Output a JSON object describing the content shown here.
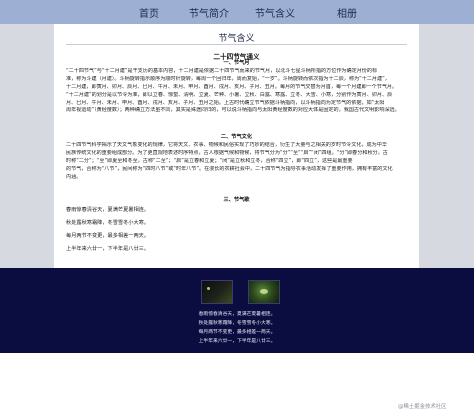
{
  "nav": {
    "items": [
      {
        "label": "首页"
      },
      {
        "label": "节气简介"
      },
      {
        "label": "节气含义"
      },
      {
        "label": "相册"
      }
    ]
  },
  "page": {
    "title": "节气含义"
  },
  "article": {
    "heading": "二十四节气通义",
    "sections": [
      {
        "title": "一、节气月",
        "lines": [
          "“二十四节气”与“十二月建”是干支历的基本内容，十二月建是依据二十四节气而来的节气月，以北斗七星斗柄所指的方位作为确定月份的标",
          "准，称为斗建（月建）。斗柄旋转指示顺序为顺时针旋转，每周一个回归年，周而复始，“一岁”。斗柄旋转而依次指为十二辰，称为“十二月建”，",
          "十二月建，即寅月、卯月、辰月、巳月、午月、未月、申月、酉月、戌月、亥月、子月、丑月。每月的节气交替为月首，每一个月建即一个节气月。",
          "“十二月建”的划分是以节令为准，即以立春、惊蛰、清明、立夏、芒种、小暑、立秋、白露、寒露、立冬、大雪、小寒，分别作为寅月、卯月、辰",
          "月、巳月、午月、未月、申月、酉月、戌月、亥月、子月、丑月之始。上古时代确立节气依据斗柄指向，以斗柄指向为定节气的依据，如“太阳",
          "周年视运动”（黄经度数）；两种确立方法虽不同，其实是殊途同归的，可以说斗柄指向与太阳黄经度数的对应大体是固定的，我国古代文明影响深远。"
        ]
      },
      {
        "title": "二、节气文化",
        "lines": [
          "二十四节气科学揭示了天文气象变化的规律，它将天文、农事、物候和民俗实现了巧妙的结合，衍生了大量与之相关的岁时节令文化，成为中华",
          "民族传统文化的重要组成部分。为了更直观地表述时序特点，古人根据气候和物候，将节气分为“分”“至”“启”“闭”四组。“分”即春分和秋分，古",
          "时称“二分”；“至”即夏至和冬至，古称“二至”；“启”是立春和立夏；“闭”是立秋和立冬，合称“四立”，即“四立”，这些是最重要",
          "的节气，合称为“八节”，民间称为“四时八节”或“时年八节”。在漫长的农耕社会中，二十四节气为指导农事活动发挥了重要作用，拥有丰富的文化",
          "内涵。"
        ]
      },
      {
        "title": "三、节气歌",
        "lines": [
          "春雨惊春清谷天，夏满芒夏暑相连。",
          "秋处露秋寒霜降，冬雪雪冬小大寒。",
          "每月两节不变更，最多相差一两天。",
          "上半年来六廿一，下半年是八廿三。"
        ]
      }
    ]
  },
  "footer": {
    "images": [
      {
        "alt": "夜景星空图片"
      },
      {
        "alt": "绿色萤火图片"
      }
    ],
    "poem": [
      "春雨惊春清谷天，夏满芒夏暑相连。",
      "秋处露秋寒霜降，冬雪雪冬小大寒。",
      "每月两节不变更，最多相差一两天。",
      "上半年来六廿一，下半年是八廿三。"
    ]
  },
  "watermark": "@稀土掘金技术社区"
}
